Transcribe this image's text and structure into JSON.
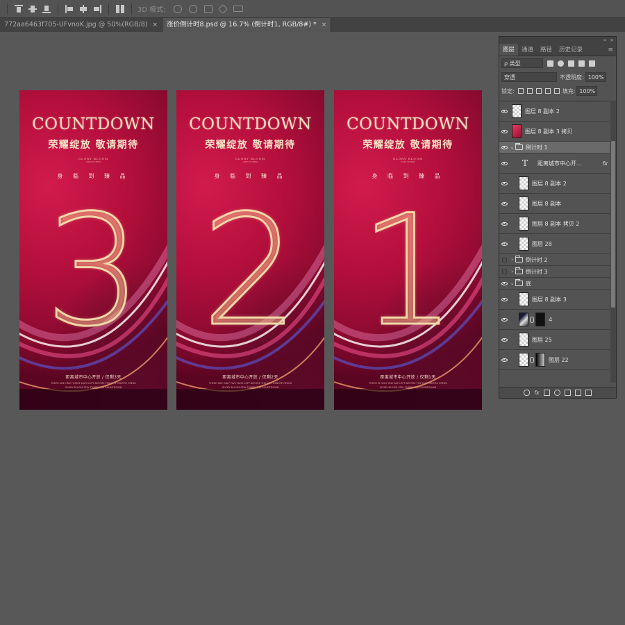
{
  "toolbar": {
    "mode_3d_label": "3D 模式:",
    "icons": [
      "align-top-icon",
      "align-vcenter-icon",
      "align-bottom-icon",
      "align-left-icon",
      "align-hcenter-icon",
      "align-right-icon",
      "distribute-icon",
      "3d-rotate-icon",
      "3d-roll-icon",
      "3d-pan-icon",
      "3d-slide-icon",
      "3d-scale-icon"
    ]
  },
  "tabs": [
    {
      "label": "772aa6463f705-UFvnoK.jpg @ 50%(RGB/8)",
      "close": "×",
      "active": false
    },
    {
      "label": "涨价倒计时8.psd @ 16.7% (倒计时1, RGB/8#) *",
      "close": "×",
      "active": true
    }
  ],
  "posters": [
    {
      "title": "COUNTDOWN",
      "subtitle": "荣耀绽放  敬请期待",
      "glory": "GLORY BLOOM",
      "glory_sub": "STAY TUNED",
      "tagline": "身 临 到 臻 品",
      "number": "3",
      "footer": "距离城市中心开放 / 仅剩3天",
      "footer_en1": "THERE ARE ONLY THREE DAYS LEFT BEFORE THE CITY CENTRE OPENS",
      "footer_en2": "GLORY BLOOM STAY TUNED THE COUNTDOWN"
    },
    {
      "title": "COUNTDOWN",
      "subtitle": "荣耀绽放  敬请期待",
      "glory": "GLORY BLOOM",
      "glory_sub": "STAY TUNED",
      "tagline": "身 临 到 臻 品",
      "number": "2",
      "footer": "距离城市中心开放 / 仅剩2天",
      "footer_en1": "THERE ARE ONLY TWO DAYS LEFT BEFORE THE CITY CENTRE OPENS",
      "footer_en2": "GLORY BLOOM STAY TUNED THE COUNTDOWN"
    },
    {
      "title": "COUNTDOWN",
      "subtitle": "荣耀绽放  敬请期待",
      "glory": "GLORY BLOOM",
      "glory_sub": "STAY TUNED",
      "tagline": "身 临 到 臻 品",
      "number": "1",
      "footer": "距离城市中心开放 / 仅剩1天",
      "footer_en1": "THERE IS ONLY ONE DAY LEFT BEFORE THE CITY CENTRE OPENS",
      "footer_en2": "GLORY BLOOM STAY TUNED THE COUNTDOWN"
    }
  ],
  "panel": {
    "collapse": "»",
    "close": "×",
    "tabs": [
      "图层",
      "通道",
      "路径",
      "历史记录"
    ],
    "menu": "≡",
    "filter_label": "ρ 类型",
    "blend_mode": "穿透",
    "opacity_label": "不透明度:",
    "opacity_value": "100%",
    "lock_label": "锁定:",
    "fill_label": "填充:",
    "fill_value": "100%",
    "layers": [
      {
        "name": "图层 8 副本 2",
        "thumb": "checker",
        "visible": true,
        "indent": 0
      },
      {
        "name": "图层 8 副本 3 拷贝",
        "thumb": "red",
        "visible": true,
        "indent": 0
      },
      {
        "name": "倒计时 1",
        "type": "group",
        "open": true,
        "visible": true,
        "indent": 0,
        "selected": true
      },
      {
        "name": "距离城市中心开...",
        "type": "text",
        "visible": true,
        "indent": 1,
        "fx": "fx"
      },
      {
        "name": "图层 8 副本 2",
        "thumb": "checker",
        "visible": true,
        "indent": 1
      },
      {
        "name": "图层 8 副本",
        "thumb": "checker",
        "visible": true,
        "indent": 1
      },
      {
        "name": "图层 8 副本 拷贝 2",
        "thumb": "checker",
        "visible": true,
        "indent": 1
      },
      {
        "name": "图层 28",
        "thumb": "checker",
        "visible": true,
        "indent": 1
      },
      {
        "name": "倒计时 2",
        "type": "group",
        "open": false,
        "visible": false,
        "indent": 0
      },
      {
        "name": "倒计时 3",
        "type": "group",
        "open": false,
        "visible": false,
        "indent": 0
      },
      {
        "name": "底",
        "type": "group",
        "open": true,
        "visible": true,
        "indent": 0
      },
      {
        "name": "图层 8 副本 3",
        "thumb": "checker",
        "visible": true,
        "indent": 1
      },
      {
        "name": "4",
        "thumb": "dark",
        "mask": "mask",
        "visible": true,
        "indent": 1
      },
      {
        "name": "图层 25",
        "thumb": "checker",
        "visible": true,
        "indent": 1
      },
      {
        "name": "图层 22",
        "thumb": "checker",
        "mask": "mask2",
        "visible": true,
        "indent": 1
      }
    ],
    "bottom_icons": [
      "link-icon",
      "fx",
      "mask-icon",
      "adjustment-icon",
      "new-group-icon",
      "new-layer-icon",
      "delete-icon"
    ]
  }
}
